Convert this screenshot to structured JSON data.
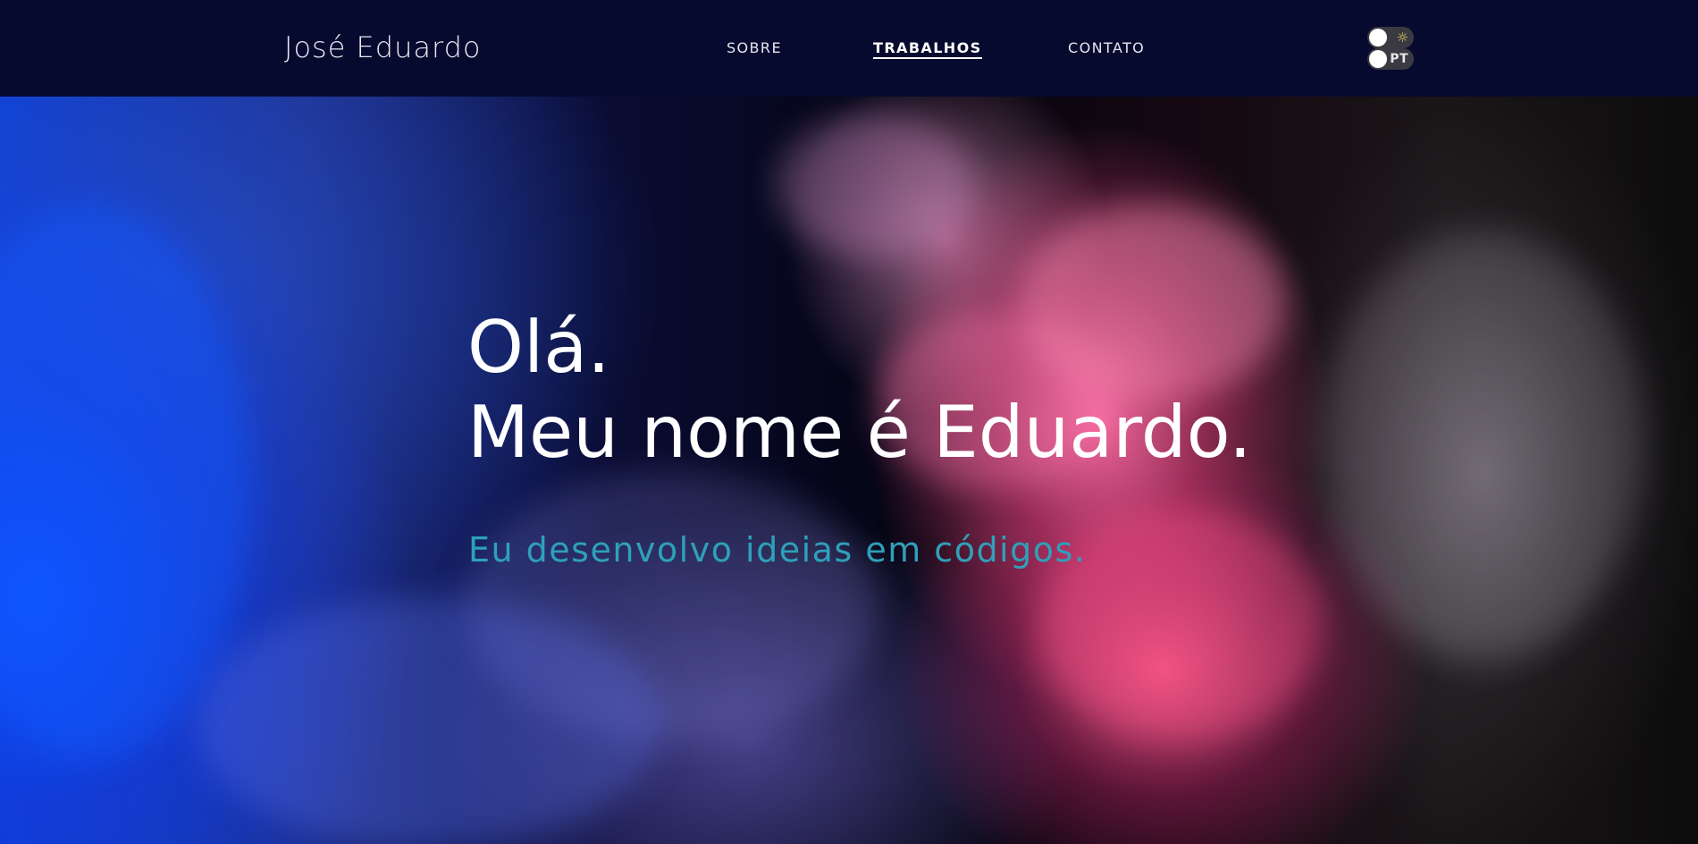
{
  "header": {
    "brand": "José Eduardo",
    "nav": [
      {
        "label": "SOBRE",
        "active": false
      },
      {
        "label": "TRABALHOS",
        "active": true
      },
      {
        "label": "CONTATO",
        "active": false
      }
    ],
    "theme_toggle": {
      "icon": "sun-icon",
      "glyph": "☼"
    },
    "language_toggle": {
      "label": "PT"
    }
  },
  "hero": {
    "greeting": "Olá.",
    "name_line": "Meu nome é Eduardo.",
    "tagline": "Eu desenvolvo ideias em códigos."
  },
  "colors": {
    "navbar_background": "#050a2e",
    "hero_text": "#ffffff",
    "tagline": "#2fa0ba",
    "toggle_track": "#3a3a42",
    "sun_icon": "#f2d55a"
  }
}
